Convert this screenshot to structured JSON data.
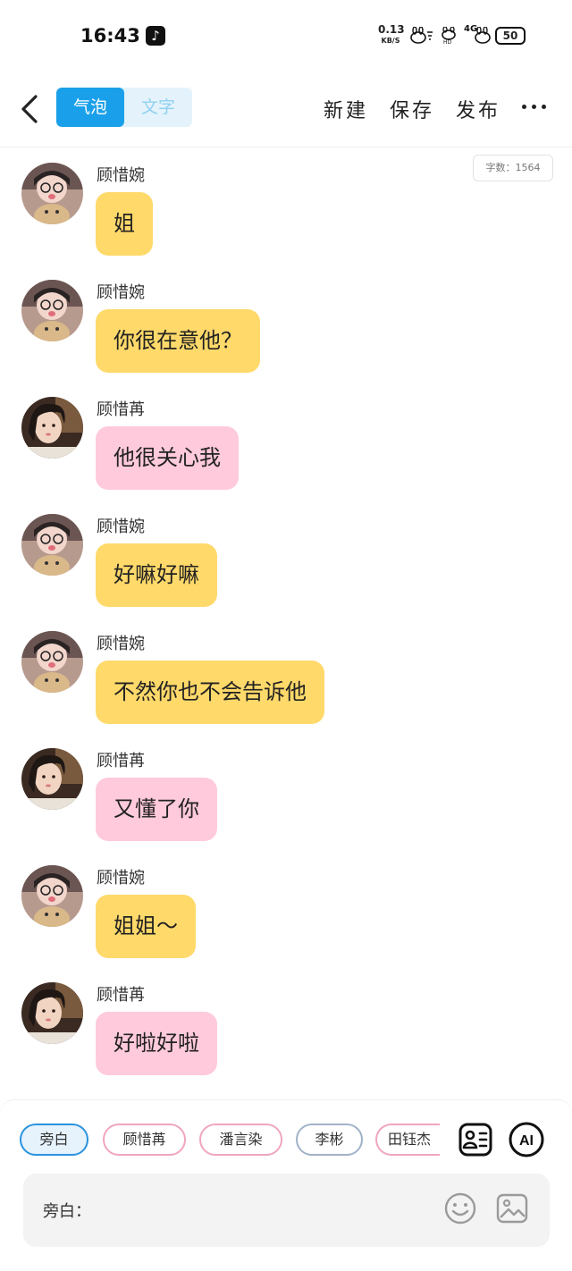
{
  "status_bar": {
    "time": "16:43",
    "net_speed_value": "0.13",
    "net_speed_unit": "KB/S",
    "network": "4G",
    "battery": "50"
  },
  "header": {
    "tabs": [
      {
        "label": "气泡",
        "active": true
      },
      {
        "label": "文字",
        "active": false
      }
    ],
    "new_label": "新建",
    "save_label": "保存",
    "publish_label": "发布"
  },
  "word_count": "字数：1564",
  "messages": [
    {
      "sender": "顾惜婉",
      "text": "姐",
      "bubble_color": "#ffd96a",
      "avatar": "avatar-wan"
    },
    {
      "sender": "顾惜婉",
      "text": "你很在意他？",
      "bubble_color": "#ffd96a",
      "avatar": "avatar-wan"
    },
    {
      "sender": "顾惜苒",
      "text": "他很关心我",
      "bubble_color": "#ffcadb",
      "avatar": "avatar-ran"
    },
    {
      "sender": "顾惜婉",
      "text": "好嘛好嘛",
      "bubble_color": "#ffd96a",
      "avatar": "avatar-wan"
    },
    {
      "sender": "顾惜婉",
      "text": "不然你也不会告诉他",
      "bubble_color": "#ffd96a",
      "avatar": "avatar-wan"
    },
    {
      "sender": "顾惜苒",
      "text": "又懂了你",
      "bubble_color": "#ffcadb",
      "avatar": "avatar-ran"
    },
    {
      "sender": "顾惜婉",
      "text": "姐姐～",
      "bubble_color": "#ffd96a",
      "avatar": "avatar-wan"
    },
    {
      "sender": "顾惜苒",
      "text": "好啦好啦",
      "bubble_color": "#ffcadb",
      "avatar": "avatar-ran"
    }
  ],
  "characters": [
    {
      "label": "旁白",
      "selected": true
    },
    {
      "label": "顾惜苒",
      "selected": false
    },
    {
      "label": "潘言染",
      "selected": false
    },
    {
      "label": "李彬",
      "selected": false
    },
    {
      "label": "田钰杰",
      "selected": false
    }
  ],
  "ai_label": "AI",
  "input": {
    "prefix": "旁白："
  },
  "colors": {
    "accent": "#1aa0ea",
    "bubble_yellow": "#ffd96a",
    "bubble_pink": "#ffcadb"
  }
}
